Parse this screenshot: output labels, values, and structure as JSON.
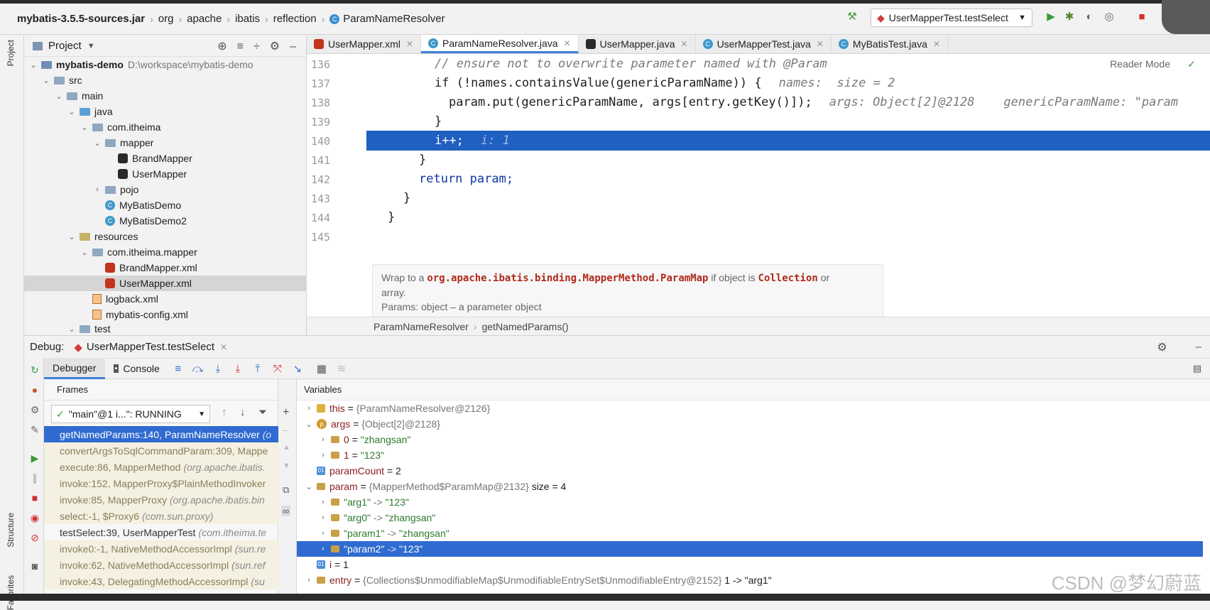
{
  "navbar": {
    "crumbs": [
      "mybatis-3.5.5-sources.jar",
      "org",
      "apache",
      "ibatis",
      "reflection",
      "ParamNameResolver"
    ],
    "run_config": "UserMapperTest.testSelect"
  },
  "project": {
    "title": "Project",
    "tree": [
      {
        "label": "mybatis-demo",
        "extra": "D:\\workspace\\mybatis-demo"
      },
      {
        "label": "src"
      },
      {
        "label": "main"
      },
      {
        "label": "java"
      },
      {
        "label": "com.itheima"
      },
      {
        "label": "mapper"
      },
      {
        "label": "BrandMapper"
      },
      {
        "label": "UserMapper"
      },
      {
        "label": "pojo"
      },
      {
        "label": "MyBatisDemo"
      },
      {
        "label": "MyBatisDemo2"
      },
      {
        "label": "resources"
      },
      {
        "label": "com.itheima.mapper"
      },
      {
        "label": "BrandMapper.xml"
      },
      {
        "label": "UserMapper.xml"
      },
      {
        "label": "logback.xml"
      },
      {
        "label": "mybatis-config.xml"
      },
      {
        "label": "test"
      }
    ]
  },
  "tabs": [
    {
      "label": "UserMapper.xml"
    },
    {
      "label": "ParamNameResolver.java"
    },
    {
      "label": "UserMapper.java"
    },
    {
      "label": "UserMapperTest.java"
    },
    {
      "label": "MyBatisTest.java"
    }
  ],
  "editor": {
    "reader_mode": "Reader Mode",
    "lines": [
      {
        "num": "136",
        "code": "// ensure not to overwrite parameter named with @Param",
        "hint": ""
      },
      {
        "num": "137",
        "code": "if (!names.containsValue(genericParamName)) {",
        "hint": "names:  size = 2"
      },
      {
        "num": "138",
        "code": "param.put(genericParamName, args[entry.getKey()]);",
        "hint": "args: Object[2]@2128    genericParamName: \"param"
      },
      {
        "num": "139",
        "code": "}",
        "hint": ""
      },
      {
        "num": "140",
        "code": "i++;",
        "hint": "i: 1"
      },
      {
        "num": "141",
        "code": "}",
        "hint": ""
      },
      {
        "num": "142",
        "code": "return param;",
        "hint": ""
      },
      {
        "num": "143",
        "code": "}",
        "hint": ""
      },
      {
        "num": "144",
        "code": "}",
        "hint": ""
      },
      {
        "num": "145",
        "code": "",
        "hint": ""
      }
    ],
    "doc": {
      "prefix": "Wrap to a ",
      "class": "org.apache.ibatis.binding.MapperMethod.ParamMap",
      "mid": " if object is ",
      "coll": "Collection",
      "suffix": " or",
      "line2": "array.",
      "params": "Params:  object – a parameter object"
    },
    "breadcrumb": [
      "ParamNameResolver",
      "getNamedParams()"
    ]
  },
  "debug": {
    "label": "Debug:",
    "session": "UserMapperTest.testSelect",
    "tab_debugger": "Debugger",
    "tab_console": "Console",
    "frames_title": "Frames",
    "variables_title": "Variables",
    "thread": "\"main\"@1 i...\": RUNNING",
    "frames": [
      {
        "method": "getNamedParams:140, ParamNameResolver",
        "pkg": "(o"
      },
      {
        "method": "convertArgsToSqlCommandParam:309, Mappe",
        "pkg": ""
      },
      {
        "method": "execute:86, MapperMethod",
        "pkg": "(org.apache.ibatis."
      },
      {
        "method": "invoke:152, MapperProxy$PlainMethodInvoker",
        "pkg": ""
      },
      {
        "method": "invoke:85, MapperProxy",
        "pkg": "(org.apache.ibatis.bin"
      },
      {
        "method": "select:-1, $Proxy6",
        "pkg": "(com.sun.proxy)"
      },
      {
        "method": "testSelect:39, UserMapperTest",
        "pkg": "(com.itheima.te"
      },
      {
        "method": "invoke0:-1, NativeMethodAccessorImpl",
        "pkg": "(sun.re"
      },
      {
        "method": "invoke:62, NativeMethodAccessorImpl",
        "pkg": "(sun.ref"
      },
      {
        "method": "invoke:43, DelegatingMethodAccessorImpl",
        "pkg": "(su"
      }
    ],
    "variables": [
      {
        "name": "this",
        "value": "{ParamNameResolver@2126}"
      },
      {
        "name": "args",
        "value": "{Object[2]@2128}"
      },
      {
        "name": "0",
        "value": "\"zhangsan\""
      },
      {
        "name": "1",
        "value": "\"123\""
      },
      {
        "name": "paramCount",
        "value": "2"
      },
      {
        "name": "param",
        "value": "{MapperMethod$ParamMap@2132}",
        "extra": "size = 4"
      },
      {
        "name": "\"arg1\"",
        "value": "\"123\""
      },
      {
        "name": "\"arg0\"",
        "value": "\"zhangsan\""
      },
      {
        "name": "\"param1\"",
        "value": "\"zhangsan\""
      },
      {
        "name": "\"param2\"",
        "value": "\"123\""
      },
      {
        "name": "i",
        "value": "1"
      },
      {
        "name": "entry",
        "value": "{Collections$UnmodifiableMap$UnmodifiableEntrySet$UnmodifiableEntry@2152}",
        "extra": "1 -> \"arg1\""
      }
    ]
  },
  "side_labels": {
    "project": "Project",
    "structure": "Structure",
    "favorites": "Favorites"
  },
  "watermark": "CSDN @梦幻蔚蓝"
}
